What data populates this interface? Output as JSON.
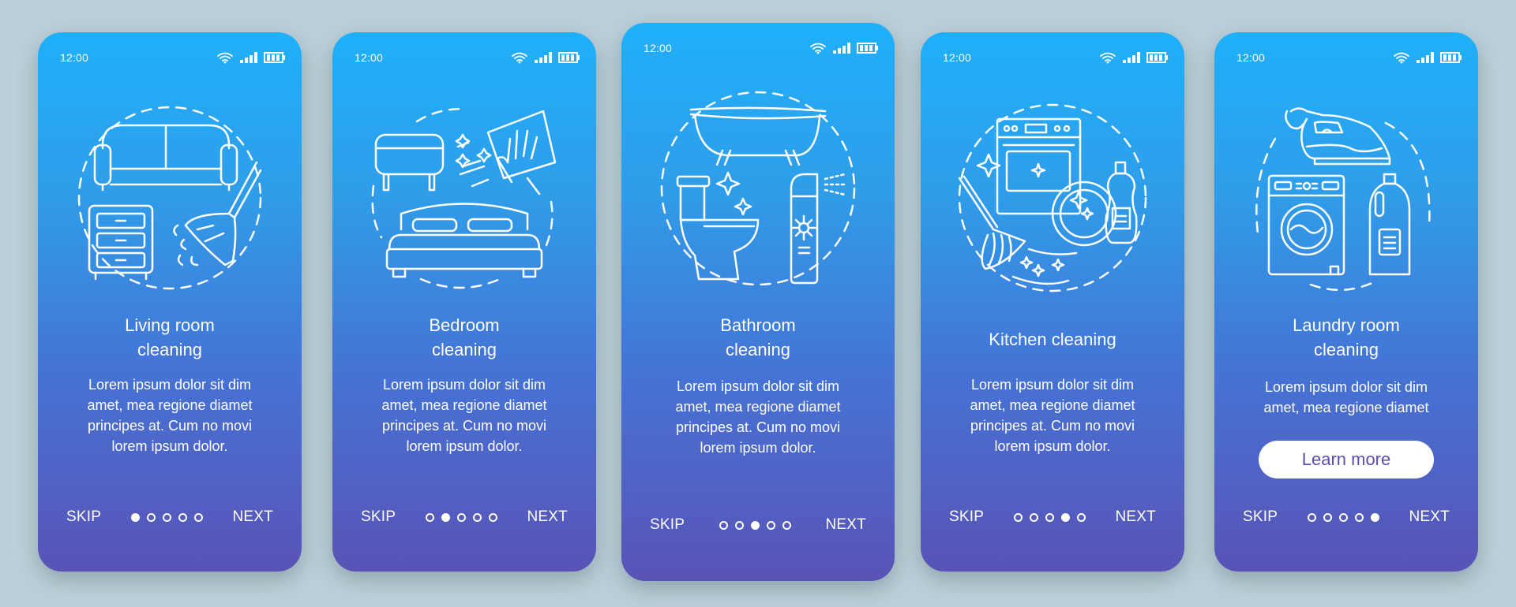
{
  "screens": [
    {
      "time": "12:00",
      "illustration": "living-room-illustration",
      "title_lines": [
        "Living room",
        "cleaning"
      ],
      "description_lines": [
        "Lorem ipsum dolor sit dim",
        "amet, mea regione diamet",
        "principes at. Cum no movi",
        "lorem ipsum dolor."
      ],
      "skip_label": "SKIP",
      "next_label": "NEXT",
      "active_page": 1,
      "page_count": 5
    },
    {
      "time": "12:00",
      "illustration": "bedroom-illustration",
      "title_lines": [
        "Bedroom",
        "cleaning"
      ],
      "description_lines": [
        "Lorem ipsum dolor sit dim",
        "amet, mea regione diamet",
        "principes at. Cum no movi",
        "lorem ipsum dolor."
      ],
      "skip_label": "SKIP",
      "next_label": "NEXT",
      "active_page": 2,
      "page_count": 5
    },
    {
      "time": "12:00",
      "illustration": "bathroom-illustration",
      "title_lines": [
        "Bathroom",
        "cleaning"
      ],
      "description_lines": [
        "Lorem ipsum dolor sit dim",
        "amet, mea regione diamet",
        "principes at. Cum no movi",
        "lorem ipsum dolor."
      ],
      "skip_label": "SKIP",
      "next_label": "NEXT",
      "active_page": 3,
      "page_count": 5
    },
    {
      "time": "12:00",
      "illustration": "kitchen-illustration",
      "title_lines": [
        "Kitchen cleaning"
      ],
      "description_lines": [
        "Lorem ipsum dolor sit dim",
        "amet, mea regione diamet",
        "principes at. Cum no movi",
        "lorem ipsum dolor."
      ],
      "skip_label": "SKIP",
      "next_label": "NEXT",
      "active_page": 4,
      "page_count": 5
    },
    {
      "time": "12:00",
      "illustration": "laundry-illustration",
      "title_lines": [
        "Laundry room",
        "cleaning"
      ],
      "description_lines": [
        "Lorem ipsum dolor sit dim",
        "amet, mea regione diamet"
      ],
      "cta_label": "Learn more",
      "skip_label": "SKIP",
      "next_label": "NEXT",
      "active_page": 5,
      "page_count": 5
    }
  ],
  "status_icons": [
    "wifi-icon",
    "signal-icon",
    "battery-icon"
  ],
  "colors": {
    "background": "#bcd0d9",
    "gradient_top": "#1fb0fb",
    "gradient_bottom": "#5a53b6",
    "cta_text": "#5a4db3",
    "foreground": "#ffffff"
  }
}
